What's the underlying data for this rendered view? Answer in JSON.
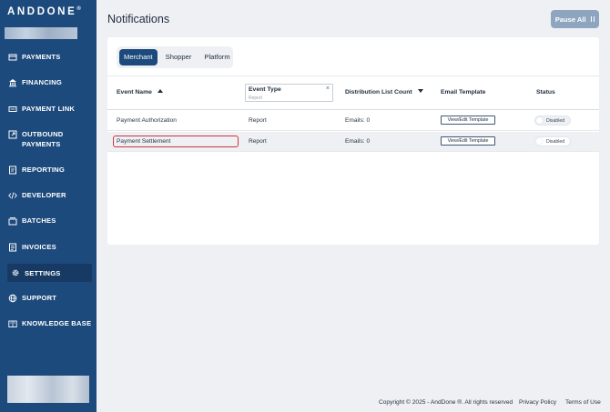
{
  "sidebar": {
    "brand": "ANDDONE",
    "brand_mark": "®",
    "items": [
      {
        "label": "PAYMENTS",
        "icon": "payments-icon"
      },
      {
        "label": "FINANCING",
        "icon": "bank-icon"
      },
      {
        "label": "PAYMENT LINK",
        "icon": "payment-link-icon"
      },
      {
        "label": "OUTBOUND",
        "label2": "PAYMENTS",
        "icon": "outbound-payments-icon"
      },
      {
        "label": "REPORTING",
        "icon": "reporting-icon"
      },
      {
        "label": "DEVELOPER",
        "icon": "code-icon"
      },
      {
        "label": "BATCHES",
        "icon": "batches-icon"
      },
      {
        "label": "INVOICES",
        "icon": "invoices-icon"
      },
      {
        "label": "SETTINGS",
        "icon": "gear-icon",
        "active": true
      },
      {
        "label": "SUPPORT",
        "icon": "globe-icon"
      },
      {
        "label": "KNOWLEDGE BASE",
        "icon": "book-icon"
      }
    ]
  },
  "header": {
    "title": "Notifications",
    "pause_label": "Pause All"
  },
  "tabs": [
    "Merchant",
    "Shopper",
    "Platform"
  ],
  "table": {
    "columns": {
      "event_name": "Event Name",
      "event_type": "Event Type",
      "event_type_value": "Report",
      "distribution": "Distribution List Count",
      "email_template": "Email Template",
      "status": "Status"
    },
    "rows": [
      {
        "event_name": "Payment Authorization",
        "event_type": "Report",
        "emails": "Emails: 0",
        "template": "View/Edit Template",
        "status": "Disabled",
        "highlighted": false
      },
      {
        "event_name": "Payment Settlement",
        "event_type": "Report",
        "emails": "Emails: 0",
        "template": "View/Edit Template",
        "status": "Disabled",
        "highlighted": true
      }
    ]
  },
  "footer": {
    "copyright": "Copyright © 2025 - AndDone ®. All rights reserved",
    "privacy": "Privacy Policy",
    "terms": "Terms of Use"
  },
  "colors": {
    "sidebar": "#1d4a7c",
    "sidebar_active": "#163a63",
    "accent": "#1d4a7c",
    "pause_button": "#8ea5c0",
    "highlight": "#d0333f"
  }
}
